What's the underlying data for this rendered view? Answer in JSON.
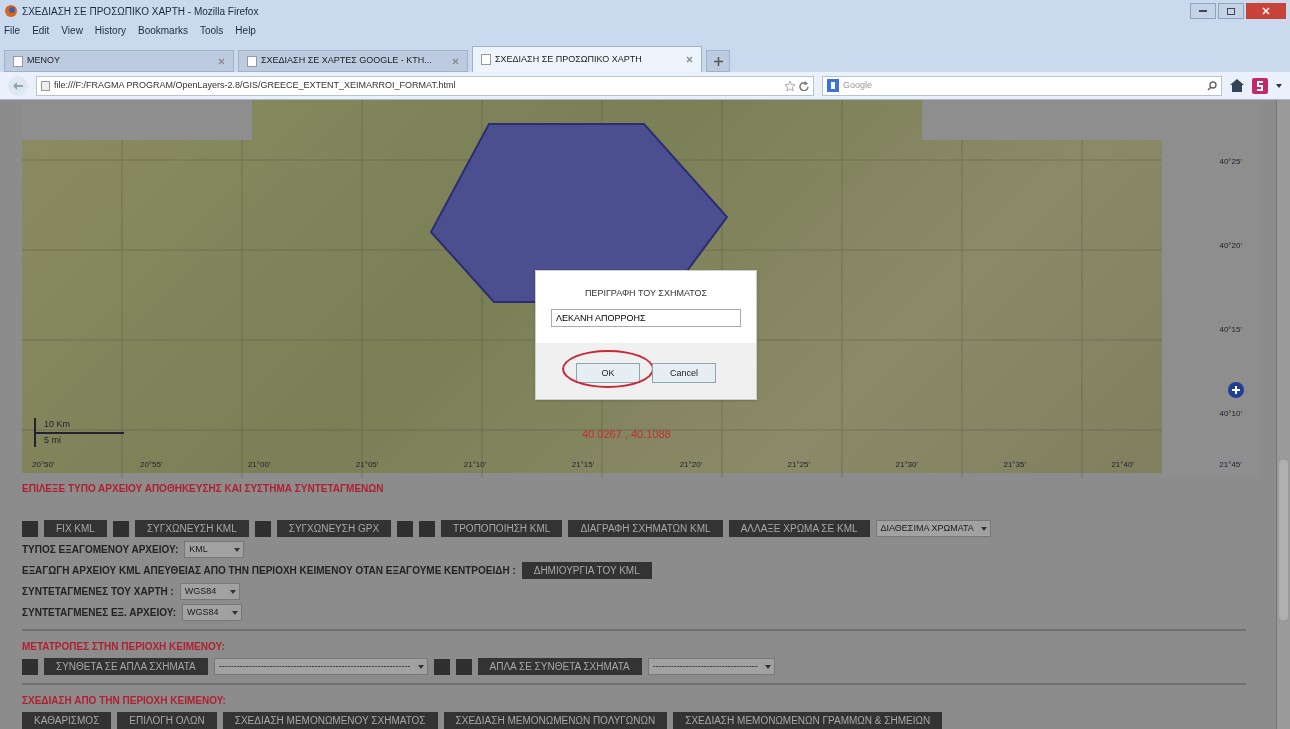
{
  "window": {
    "title": "ΣΧΕΔΙΑΣΗ ΣΕ ΠΡΟΣΩΠΙΚΟ ΧΑΡΤΗ - Mozilla Firefox"
  },
  "menu": [
    "File",
    "Edit",
    "View",
    "History",
    "Bookmarks",
    "Tools",
    "Help"
  ],
  "tabs": [
    {
      "label": "MENOY",
      "selected": false
    },
    {
      "label": "ΣΧΕΔΙΑΣΗ ΣΕ ΧΑΡΤΕΣ GOOGLE - ΚΤΗ...",
      "selected": false
    },
    {
      "label": "ΣΧΕΔΙΑΣΗ ΣΕ ΠΡΟΣΩΠΙΚΟ ΧΑΡΤΗ",
      "selected": true
    }
  ],
  "address_bar": {
    "url": "file:///F:/FRAGMA PROGRAM/OpenLayers-2.8/GIS/GREECE_EXTENT_XEIMARROI_FORMAT.html"
  },
  "search": {
    "placeholder": "Google"
  },
  "map": {
    "scale_labels": [
      "10 Km",
      "5 mi"
    ],
    "coordinates": "40.0267 , 40.1088",
    "lat_labels": [
      "40°25'",
      "40°20'",
      "40°15'",
      "40°10'"
    ],
    "lon_labels": [
      "20°50'",
      "20°55'",
      "21°00'",
      "21°05'",
      "21°10'",
      "21°15'",
      "21°20'",
      "21°25'",
      "21°30'",
      "21°35'",
      "21°40'",
      "21°45'"
    ]
  },
  "dialog": {
    "prompt": "ΠΕΡΙΓΡΑΦΗ ΤΟΥ ΣΧΗΜΑΤΟΣ",
    "value": "ΛΕΚΑΝΗ ΑΠΟΡΡΟΗΣ",
    "buttons": [
      {
        "label": "OK",
        "circled": true
      },
      {
        "label": "Cancel",
        "circled": false
      }
    ]
  },
  "sections": [
    {
      "heading": "ΕΠΙΛΕΞΕ ΤΥΠΟ ΑΡΧΕΙΟΥ ΑΠΟΘΗΚΕΥΣΗΣ ΚΑΙ ΣΥΣΤΗΜΑ ΣΥΝΤΕΤΑΓΜΕΝΩΝ",
      "lines": [
        [
          {
            "kind": "square"
          },
          {
            "kind": "button",
            "label": "FIX KML"
          },
          {
            "kind": "square"
          },
          {
            "kind": "button",
            "label": "ΣΥΓΧΩΝΕΥΣΗ KML"
          },
          {
            "kind": "square"
          },
          {
            "kind": "button",
            "label": "ΣΥΓΧΩΝΕΥΣΗ GPX"
          },
          {
            "kind": "square"
          },
          {
            "kind": "square"
          },
          {
            "kind": "button",
            "label": "ΤΡΟΠΟΠΟΙΗΣΗ KML"
          },
          {
            "kind": "button",
            "label": "ΔΙΑΓΡΑΦΗ ΣΧΗΜΑΤΩΝ KML"
          },
          {
            "kind": "button",
            "label": "ΑΛΛΑΞΕ ΧΡΩΜΑ ΣΕ KML"
          },
          {
            "kind": "select",
            "value": "ΔΙΑΘΕΣΙΜΑ ΧΡΩΜΑΤΑ"
          }
        ],
        [
          {
            "kind": "label",
            "text": "ΤΥΠΟΣ ΕΞΑΓΟΜΕΝΟΥ ΑΡΧΕΙΟΥ:"
          },
          {
            "kind": "select",
            "value": "KML"
          }
        ],
        [
          {
            "kind": "label",
            "text": "ΕΞΑΓΩΓΗ ΑΡΧΕΙΟΥ KML ΑΠΕΥΘΕΙΑΣ ΑΠΟ ΤΗΝ ΠΕΡΙΟΧΗ ΚΕΙΜΕΝΟΥ ΟΤΑΝ ΕΞΑΓΟΥΜΕ ΚΕΝΤΡΟΕΙΔΗ :"
          },
          {
            "kind": "button",
            "label": "ΔΗΜΙΟΥΡΓΙΑ ΤΟΥ KML"
          }
        ],
        [
          {
            "kind": "label",
            "text": "ΣΥΝΤΕΤΑΓΜΕΝΕΣ ΤΟΥ ΧΑΡΤΗ :"
          },
          {
            "kind": "select",
            "value": "WGS84"
          }
        ],
        [
          {
            "kind": "label",
            "text": "ΣΥΝΤΕΤΑΓΜΕΝΕΣ ΕΞ. ΑΡΧΕΙΟΥ:"
          },
          {
            "kind": "select",
            "value": "WGS84"
          }
        ]
      ]
    },
    {
      "heading": "ΜΕΤΑΤΡΟΠΕΣ ΣΤΗΝ ΠΕΡΙΟΧΗ ΚΕΙΜΕΝΟΥ:",
      "lines": [
        [
          {
            "kind": "square"
          },
          {
            "kind": "button",
            "label": "ΣΥΝΘΕΤΑ ΣΕ ΑΠΛΑ ΣΧΗΜΑΤΑ"
          },
          {
            "kind": "select",
            "value": "----------------------------------------------------------------"
          },
          {
            "kind": "square"
          },
          {
            "kind": "square"
          },
          {
            "kind": "button",
            "label": "ΑΠΛΑ ΣΕ ΣΥΝΘΕΤΑ ΣΧΗΜΑΤΑ"
          },
          {
            "kind": "select",
            "value": "-----------------------------------"
          }
        ]
      ]
    },
    {
      "heading": "ΣΧΕΔΙΑΣΗ ΑΠΟ ΤΗΝ ΠΕΡΙΟΧΗ ΚΕΙΜΕΝΟΥ:",
      "lines": [
        [
          {
            "kind": "button",
            "label": "ΚΑΘΑΡΙΣΜΟΣ"
          },
          {
            "kind": "button",
            "label": "ΕΠΙΛΟΓΗ ΟΛΩΝ"
          },
          {
            "kind": "button",
            "label": "ΣΧΕΔΙΑΣΗ ΜΕΜΟΝΩΜΕΝΟΥ ΣΧΗΜΑΤΟΣ"
          },
          {
            "kind": "button",
            "label": "ΣΧΕΔΙΑΣΗ ΜΕΜΟΝΩΜΕΝΩΝ ΠΟΛΥΓΩΝΩΝ"
          },
          {
            "kind": "button",
            "label": "ΣΧΕΔΙΑΣΗ ΜΕΜΟΝΩΜΕΝΩΝ ΓΡΑΜΜΩΝ & ΣΗΜΕΙΩΝ"
          }
        ]
      ]
    }
  ]
}
